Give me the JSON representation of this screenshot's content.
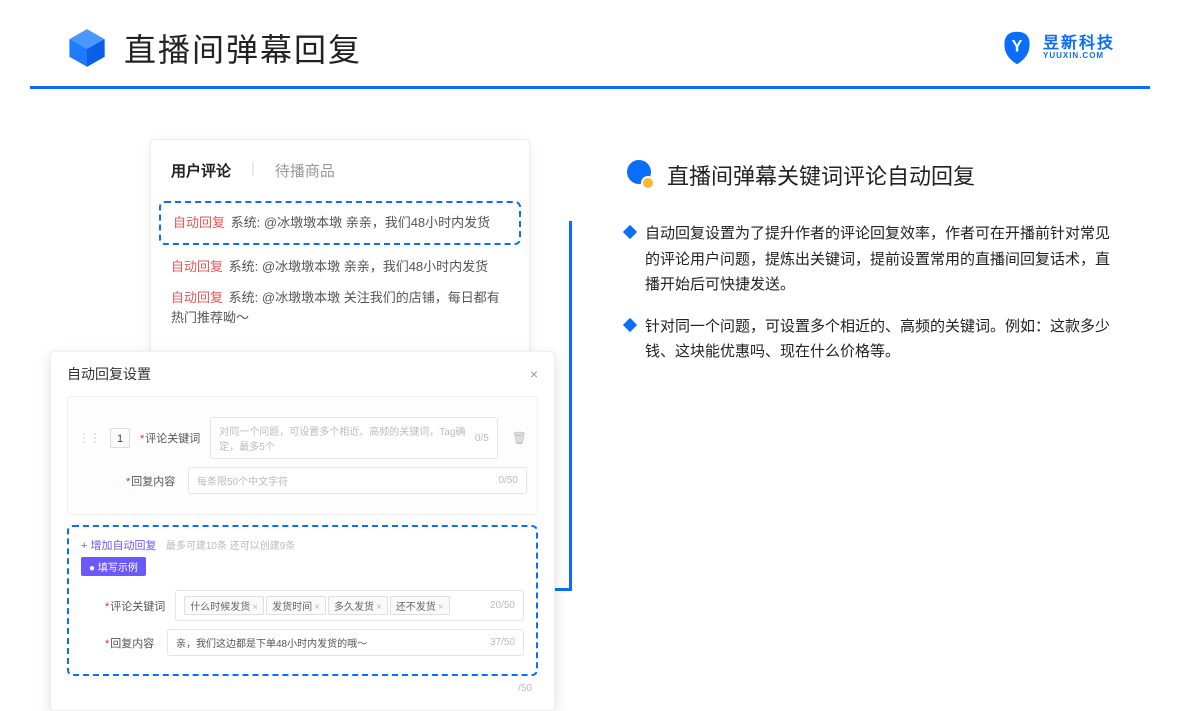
{
  "header": {
    "title": "直播间弹幕回复",
    "brand_zh": "昱新科技",
    "brand_en": "YUUXIN.COM"
  },
  "panel_comments": {
    "tab_active": "用户评论",
    "tab_pending": "待播商品",
    "rows": [
      {
        "tag": "自动回复",
        "sys": "系统:",
        "text": "@冰墩墩本墩 亲亲，我们48小时内发货"
      },
      {
        "tag": "自动回复",
        "sys": "系统:",
        "text": "@冰墩墩本墩 亲亲，我们48小时内发货"
      },
      {
        "tag": "自动回复",
        "sys": "系统:",
        "text": "@冰墩墩本墩 关注我们的店铺，每日都有热门推荐呦～"
      }
    ]
  },
  "panel_settings": {
    "title": "自动回复设置",
    "idx": "1",
    "keyword_label": "评论关键词",
    "keyword_placeholder": "对同一个问题，可设置多个相近、高频的关键词，Tag确定，最多5个",
    "keyword_counter": "0/5",
    "reply_label": "回复内容",
    "reply_placeholder": "每条限50个中文字符",
    "reply_counter": "0/50",
    "add_link": "+ 增加自动回复",
    "add_hint": "最多可建10条 还可以创建9条",
    "example_badge": "● 填写示例",
    "ex_keyword_label": "评论关键词",
    "ex_tags": [
      "什么时候发货",
      "发货时间",
      "多久发货",
      "还不发货"
    ],
    "ex_keyword_counter": "20/50",
    "ex_reply_label": "回复内容",
    "ex_reply_value": "亲，我们这边都是下单48小时内发货的哦～",
    "ex_reply_counter": "37/50",
    "outer_counter": "/50"
  },
  "right": {
    "section_title": "直播间弹幕关键词评论自动回复",
    "bullets": [
      "自动回复设置为了提升作者的评论回复效率，作者可在开播前针对常见的评论用户问题，提炼出关键词，提前设置常用的直播间回复话术，直播开始后可快捷发送。",
      "针对同一个问题，可设置多个相近的、高频的关键词。例如：这款多少钱、这块能优惠吗、现在什么价格等。"
    ]
  }
}
